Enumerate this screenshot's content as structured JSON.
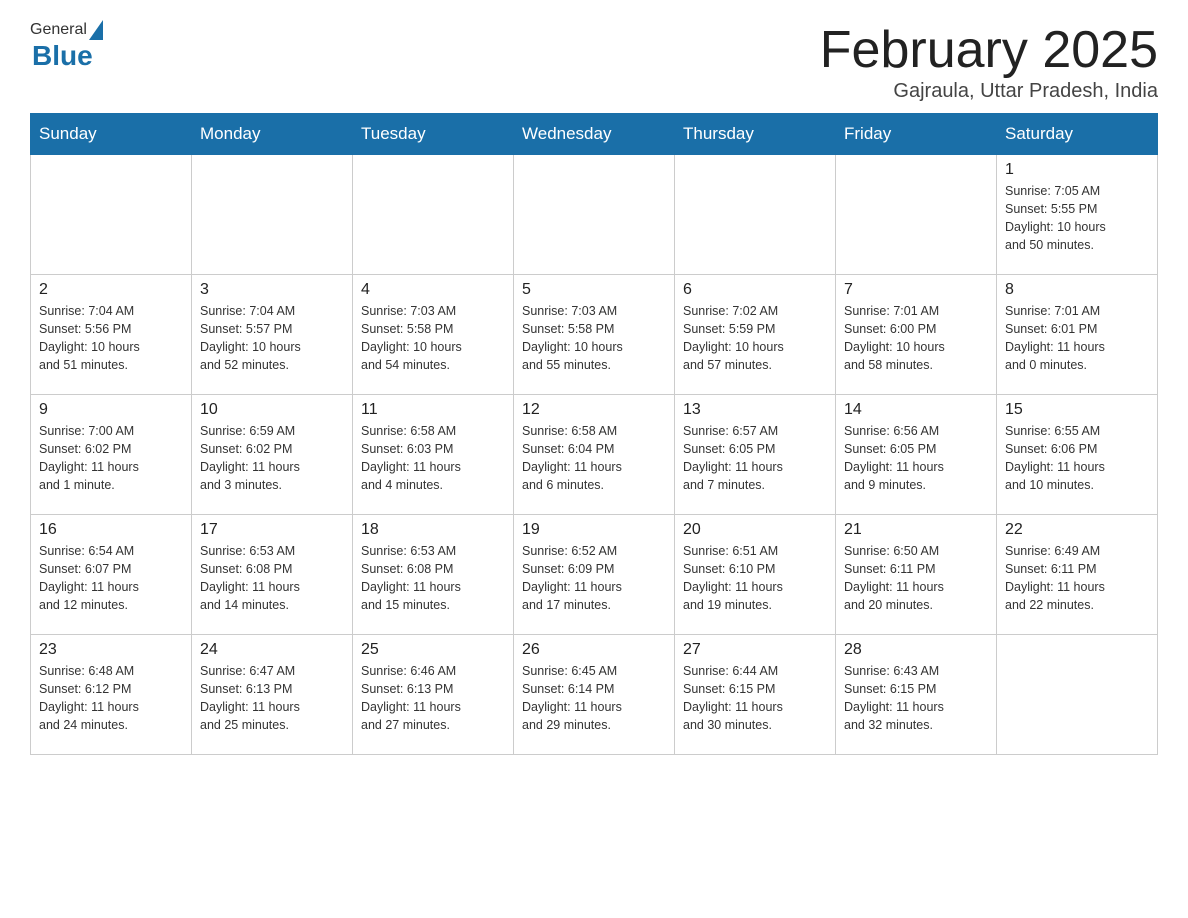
{
  "header": {
    "logo_general": "General",
    "logo_blue": "Blue",
    "month_title": "February 2025",
    "location": "Gajraula, Uttar Pradesh, India"
  },
  "days_of_week": [
    "Sunday",
    "Monday",
    "Tuesday",
    "Wednesday",
    "Thursday",
    "Friday",
    "Saturday"
  ],
  "weeks": [
    [
      {
        "day": "",
        "info": ""
      },
      {
        "day": "",
        "info": ""
      },
      {
        "day": "",
        "info": ""
      },
      {
        "day": "",
        "info": ""
      },
      {
        "day": "",
        "info": ""
      },
      {
        "day": "",
        "info": ""
      },
      {
        "day": "1",
        "info": "Sunrise: 7:05 AM\nSunset: 5:55 PM\nDaylight: 10 hours\nand 50 minutes."
      }
    ],
    [
      {
        "day": "2",
        "info": "Sunrise: 7:04 AM\nSunset: 5:56 PM\nDaylight: 10 hours\nand 51 minutes."
      },
      {
        "day": "3",
        "info": "Sunrise: 7:04 AM\nSunset: 5:57 PM\nDaylight: 10 hours\nand 52 minutes."
      },
      {
        "day": "4",
        "info": "Sunrise: 7:03 AM\nSunset: 5:58 PM\nDaylight: 10 hours\nand 54 minutes."
      },
      {
        "day": "5",
        "info": "Sunrise: 7:03 AM\nSunset: 5:58 PM\nDaylight: 10 hours\nand 55 minutes."
      },
      {
        "day": "6",
        "info": "Sunrise: 7:02 AM\nSunset: 5:59 PM\nDaylight: 10 hours\nand 57 minutes."
      },
      {
        "day": "7",
        "info": "Sunrise: 7:01 AM\nSunset: 6:00 PM\nDaylight: 10 hours\nand 58 minutes."
      },
      {
        "day": "8",
        "info": "Sunrise: 7:01 AM\nSunset: 6:01 PM\nDaylight: 11 hours\nand 0 minutes."
      }
    ],
    [
      {
        "day": "9",
        "info": "Sunrise: 7:00 AM\nSunset: 6:02 PM\nDaylight: 11 hours\nand 1 minute."
      },
      {
        "day": "10",
        "info": "Sunrise: 6:59 AM\nSunset: 6:02 PM\nDaylight: 11 hours\nand 3 minutes."
      },
      {
        "day": "11",
        "info": "Sunrise: 6:58 AM\nSunset: 6:03 PM\nDaylight: 11 hours\nand 4 minutes."
      },
      {
        "day": "12",
        "info": "Sunrise: 6:58 AM\nSunset: 6:04 PM\nDaylight: 11 hours\nand 6 minutes."
      },
      {
        "day": "13",
        "info": "Sunrise: 6:57 AM\nSunset: 6:05 PM\nDaylight: 11 hours\nand 7 minutes."
      },
      {
        "day": "14",
        "info": "Sunrise: 6:56 AM\nSunset: 6:05 PM\nDaylight: 11 hours\nand 9 minutes."
      },
      {
        "day": "15",
        "info": "Sunrise: 6:55 AM\nSunset: 6:06 PM\nDaylight: 11 hours\nand 10 minutes."
      }
    ],
    [
      {
        "day": "16",
        "info": "Sunrise: 6:54 AM\nSunset: 6:07 PM\nDaylight: 11 hours\nand 12 minutes."
      },
      {
        "day": "17",
        "info": "Sunrise: 6:53 AM\nSunset: 6:08 PM\nDaylight: 11 hours\nand 14 minutes."
      },
      {
        "day": "18",
        "info": "Sunrise: 6:53 AM\nSunset: 6:08 PM\nDaylight: 11 hours\nand 15 minutes."
      },
      {
        "day": "19",
        "info": "Sunrise: 6:52 AM\nSunset: 6:09 PM\nDaylight: 11 hours\nand 17 minutes."
      },
      {
        "day": "20",
        "info": "Sunrise: 6:51 AM\nSunset: 6:10 PM\nDaylight: 11 hours\nand 19 minutes."
      },
      {
        "day": "21",
        "info": "Sunrise: 6:50 AM\nSunset: 6:11 PM\nDaylight: 11 hours\nand 20 minutes."
      },
      {
        "day": "22",
        "info": "Sunrise: 6:49 AM\nSunset: 6:11 PM\nDaylight: 11 hours\nand 22 minutes."
      }
    ],
    [
      {
        "day": "23",
        "info": "Sunrise: 6:48 AM\nSunset: 6:12 PM\nDaylight: 11 hours\nand 24 minutes."
      },
      {
        "day": "24",
        "info": "Sunrise: 6:47 AM\nSunset: 6:13 PM\nDaylight: 11 hours\nand 25 minutes."
      },
      {
        "day": "25",
        "info": "Sunrise: 6:46 AM\nSunset: 6:13 PM\nDaylight: 11 hours\nand 27 minutes."
      },
      {
        "day": "26",
        "info": "Sunrise: 6:45 AM\nSunset: 6:14 PM\nDaylight: 11 hours\nand 29 minutes."
      },
      {
        "day": "27",
        "info": "Sunrise: 6:44 AM\nSunset: 6:15 PM\nDaylight: 11 hours\nand 30 minutes."
      },
      {
        "day": "28",
        "info": "Sunrise: 6:43 AM\nSunset: 6:15 PM\nDaylight: 11 hours\nand 32 minutes."
      },
      {
        "day": "",
        "info": ""
      }
    ]
  ]
}
